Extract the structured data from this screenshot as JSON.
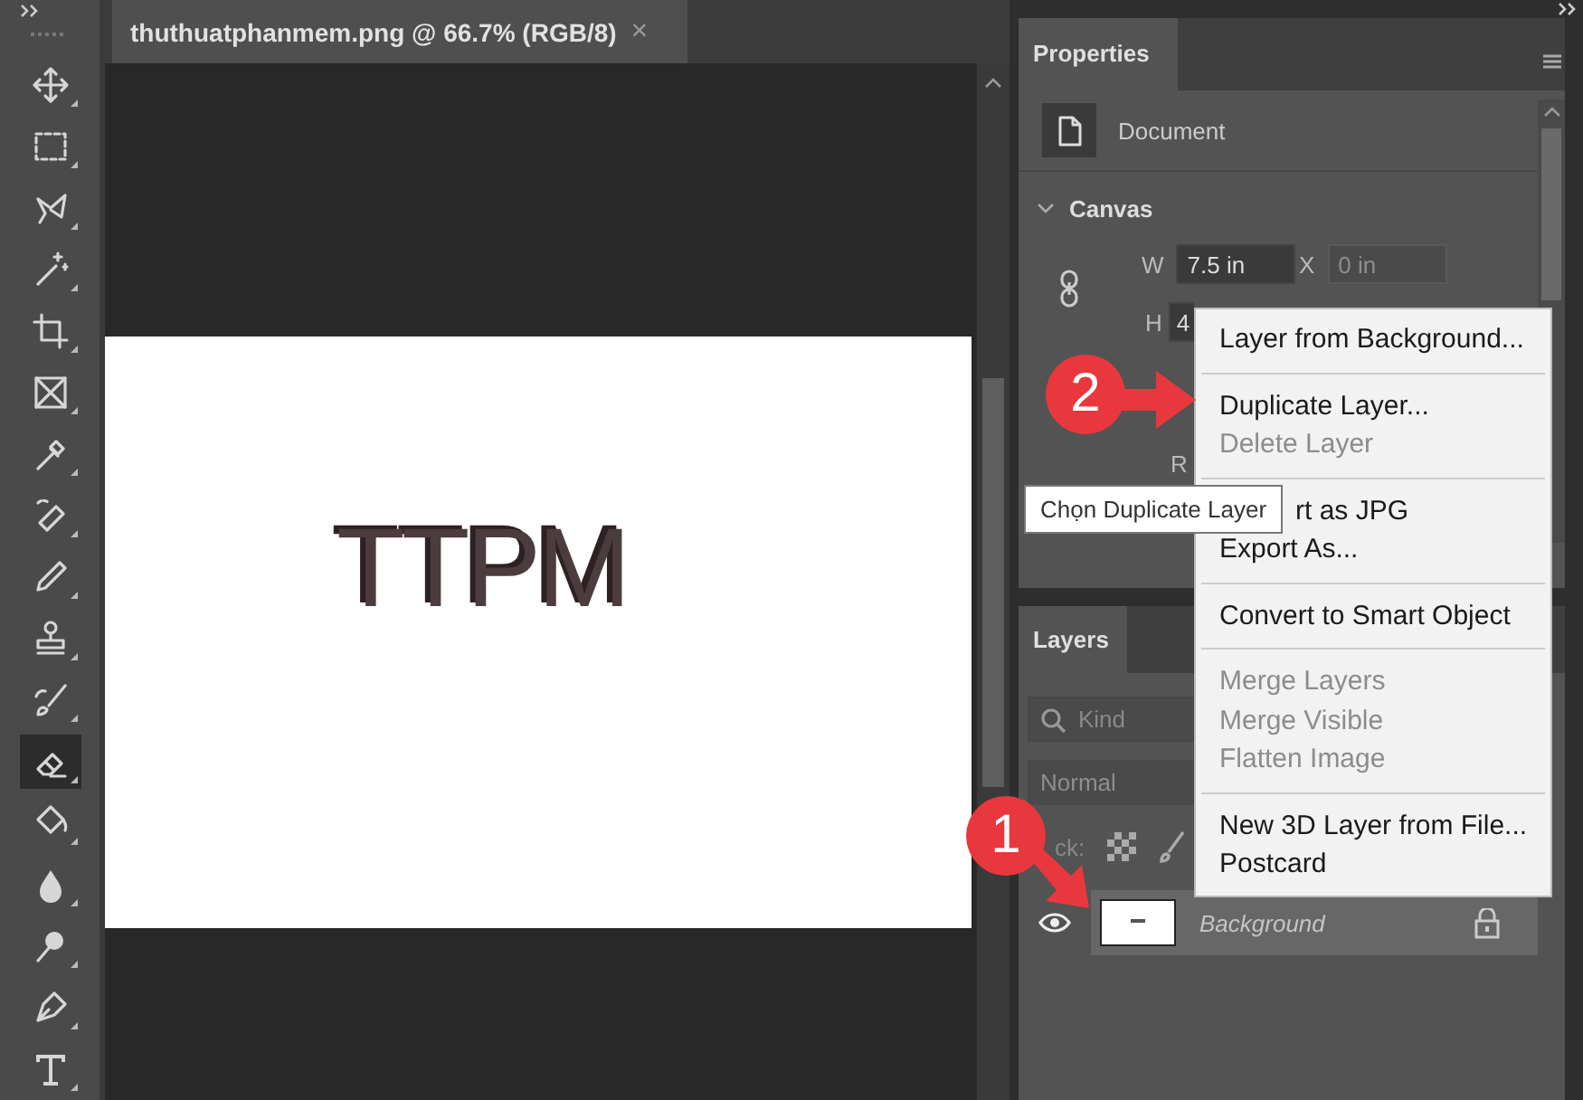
{
  "toolbar": {
    "tools": [
      {
        "kind": "move",
        "selected": false
      },
      {
        "kind": "marquee",
        "selected": false
      },
      {
        "kind": "lasso",
        "selected": false
      },
      {
        "kind": "wand",
        "selected": false
      },
      {
        "kind": "crop",
        "selected": false
      },
      {
        "kind": "frame",
        "selected": false
      },
      {
        "kind": "eyedropper",
        "selected": false
      },
      {
        "kind": "bandage",
        "selected": false
      },
      {
        "kind": "pencil",
        "selected": false
      },
      {
        "kind": "stamp",
        "selected": false
      },
      {
        "kind": "brush",
        "selected": false
      },
      {
        "kind": "eraser",
        "selected": true
      },
      {
        "kind": "bucket",
        "selected": false
      },
      {
        "kind": "drop",
        "selected": false
      },
      {
        "kind": "lollipop",
        "selected": false
      },
      {
        "kind": "pen",
        "selected": false
      },
      {
        "kind": "type",
        "selected": false
      }
    ]
  },
  "document": {
    "tab": {
      "title": "thuthuatphanmem.png @ 66.7% (RGB/8)",
      "close": "×"
    },
    "canvas_text": "TTPM"
  },
  "properties": {
    "tab": "Properties",
    "target": "Document",
    "section": "Canvas",
    "fields": [
      {
        "label": "W",
        "value": "7.5 in",
        "disabled": false
      },
      {
        "label": "X",
        "value": "0 in",
        "disabled": true
      },
      {
        "label": "H",
        "value": "4",
        "disabled": false
      }
    ],
    "r_label": "R"
  },
  "context_menu": {
    "items": [
      {
        "kind": "item",
        "label": "Layer from Background...",
        "disabled": false
      },
      {
        "kind": "separator"
      },
      {
        "kind": "item",
        "label": "Duplicate Layer...",
        "disabled": false
      },
      {
        "kind": "item",
        "label": "Delete Layer",
        "disabled": true
      },
      {
        "kind": "separator"
      },
      {
        "kind": "item",
        "label": "rt as JPG",
        "disabled": false
      },
      {
        "kind": "item",
        "label": "Export As...",
        "disabled": false
      },
      {
        "kind": "separator"
      },
      {
        "kind": "item",
        "label": "Convert to Smart Object",
        "disabled": false
      },
      {
        "kind": "separator"
      },
      {
        "kind": "item",
        "label": "Merge Layers",
        "disabled": true
      },
      {
        "kind": "item",
        "label": "Merge Visible",
        "disabled": true
      },
      {
        "kind": "item",
        "label": "Flatten Image",
        "disabled": true
      },
      {
        "kind": "separator"
      },
      {
        "kind": "item",
        "label": "New 3D Layer from File...",
        "disabled": false
      },
      {
        "kind": "item",
        "label": "Postcard",
        "disabled": false
      }
    ]
  },
  "layers": {
    "tab": "Layers",
    "search": {
      "placeholder": "Kind"
    },
    "blend_mode": "Normal",
    "lock_label": "ck:",
    "items": [
      {
        "name": "Background",
        "visible": true,
        "selected": true,
        "locked": true
      }
    ]
  },
  "tooltip": "Chọn Duplicate Layer",
  "callouts": [
    {
      "number": "2",
      "kind": "right"
    },
    {
      "number": "1",
      "kind": "down"
    }
  ]
}
